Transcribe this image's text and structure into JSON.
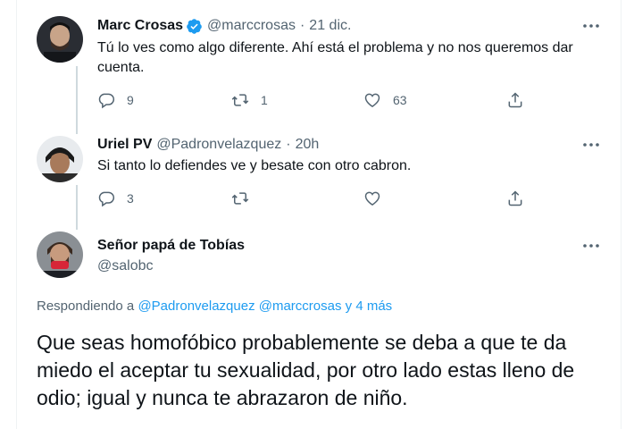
{
  "tweets": [
    {
      "name": "Marc Crosas",
      "handle": "@marccrosas",
      "separator": "·",
      "time": "21 dic.",
      "verified": true,
      "text": "Tú lo ves como algo diferente. Ahí está el problema y no nos queremos dar cuenta.",
      "reply_count": "9",
      "retweet_count": "1",
      "like_count": "63"
    },
    {
      "name": "Uriel PV",
      "handle": "@Padronvelazquez",
      "separator": "·",
      "time": "20h",
      "verified": false,
      "text": "Si tanto lo defiendes ve y besate con otro cabron.",
      "reply_count": "3",
      "retweet_count": "",
      "like_count": ""
    }
  ],
  "main_tweet": {
    "name": "Señor papá de Tobías",
    "handle": "@salobc",
    "replying_prefix": "Respondiendo a",
    "replying_to": "@Padronvelazquez @marccrosas y 4 más",
    "text": "Que seas homofóbico probablemente se deba a que te da miedo el aceptar tu sexualidad, por otro lado estas lleno de odio; igual y nunca te abrazaron de niño."
  },
  "icons": {
    "reply": "reply-icon",
    "retweet": "retweet-icon",
    "like": "heart-icon",
    "share": "share-icon",
    "more": "more-options-icon",
    "verified": "verified-badge-icon"
  },
  "colors": {
    "accent": "#1d9bf0",
    "text": "#0f1419",
    "secondary": "#536471",
    "thread_line": "#cfd9de"
  }
}
